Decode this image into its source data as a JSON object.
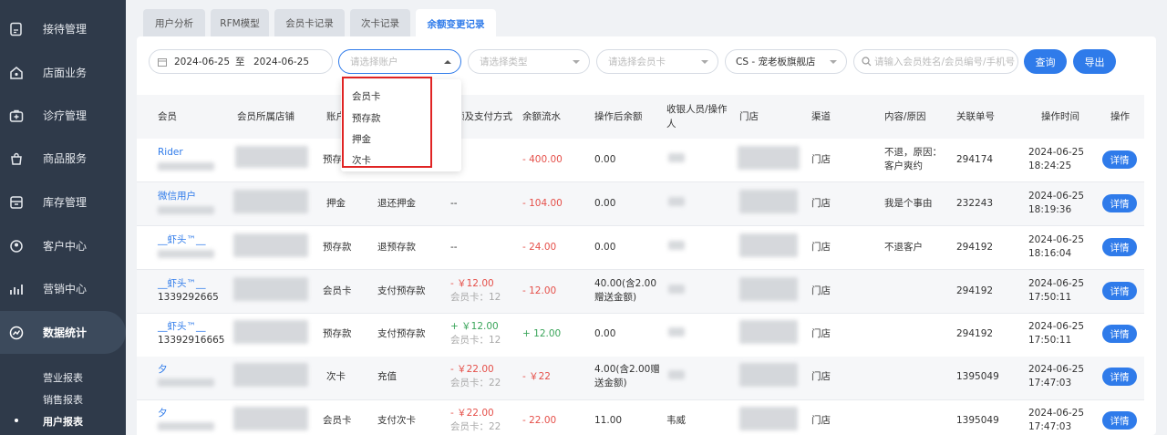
{
  "sidebar": {
    "items": [
      {
        "label": "接待管理",
        "icon": "reception-icon"
      },
      {
        "label": "店面业务",
        "icon": "store-icon"
      },
      {
        "label": "诊疗管理",
        "icon": "medical-kit-icon"
      },
      {
        "label": "商品服务",
        "icon": "goods-bag-icon"
      },
      {
        "label": "库存管理",
        "icon": "inventory-icon"
      },
      {
        "label": "客户中心",
        "icon": "customer-icon"
      },
      {
        "label": "营销中心",
        "icon": "marketing-chart-icon"
      },
      {
        "label": "数据统计",
        "icon": "statistics-icon"
      }
    ],
    "subitems": [
      "营业报表",
      "销售报表",
      "用户报表"
    ]
  },
  "tabs": [
    "用户分析",
    "RFM模型",
    "会员卡记录",
    "次卡记录",
    "余额变更记录"
  ],
  "filters": {
    "date_start": "2024-06-25",
    "date_sep": "至",
    "date_end": "2024-06-25",
    "account_placeholder": "请选择账户",
    "type_placeholder": "请选择类型",
    "card_placeholder": "请选择会员卡",
    "store": "CS - 宠老板旗舰店",
    "search_placeholder": "请输入会员姓名/会员编号/手机号",
    "query_label": "查询",
    "export_label": "导出"
  },
  "dropdown_options": [
    "会员卡",
    "预存款",
    "押金",
    "次卡"
  ],
  "columns": [
    "会员",
    "会员所属店铺",
    "账户",
    "金额及支付方式",
    "余额流水",
    "操作后余额",
    "收银人员/操作人",
    "门店",
    "渠道",
    "内容/原因",
    "关联单号",
    "操作时间",
    "操作"
  ],
  "rows": [
    {
      "member": "Rider",
      "phone": "",
      "account": "预存款",
      "type": "",
      "pay": "",
      "pay2": "",
      "flow": "- 400.00",
      "balance": "0.00",
      "staff": "",
      "channel": "门店",
      "reason": "不退，原因：客户爽约",
      "order": "294174",
      "time": "2024-06-25 18:24:25",
      "action": "详情"
    },
    {
      "member": "微信用户",
      "phone": "",
      "account": "押金",
      "type": "退还押金",
      "pay": "--",
      "pay2": "",
      "flow": "- 104.00",
      "balance": "0.00",
      "staff": "",
      "channel": "门店",
      "reason": "我是个事由",
      "order": "232243",
      "time": "2024-06-25 18:19:36",
      "action": "详情"
    },
    {
      "member": "__虾头™__",
      "phone": "",
      "account": "预存款",
      "type": "退预存款",
      "pay": "--",
      "pay2": "",
      "flow": "- 24.00",
      "balance": "0.00",
      "staff": "",
      "channel": "门店",
      "reason": "不退客户",
      "order": "294192",
      "time": "2024-06-25 18:16:04",
      "action": "详情"
    },
    {
      "member": "__虾头™__",
      "phone": "1339292665",
      "account": "会员卡",
      "type": "支付预存款",
      "pay": "- ￥12.00",
      "pay2": "会员卡：12",
      "flow": "- 12.00",
      "balance": "40.00(含2.00赠送金额)",
      "staff": "",
      "channel": "门店",
      "reason": "",
      "order": "294192",
      "time": "2024-06-25 17:50:11",
      "action": "详情"
    },
    {
      "member": "__虾头™__",
      "phone": "13392916665",
      "account": "预存款",
      "type": "支付预存款",
      "pay": "+ ￥12.00",
      "pay2": "会员卡：12",
      "flow": "+ 12.00",
      "balance": "0.00",
      "staff": "",
      "channel": "门店",
      "reason": "",
      "order": "294192",
      "time": "2024-06-25 17:50:11",
      "action": "详情"
    },
    {
      "member": "夕",
      "phone": "",
      "account": "次卡",
      "type": "充值",
      "pay": "- ￥22.00",
      "pay2": "会员卡：22",
      "flow": "- ￥22",
      "balance": "4.00(含2.00赠送金额)",
      "staff": "",
      "channel": "门店",
      "reason": "",
      "order": "1395049",
      "time": "2024-06-25 17:47:03",
      "action": "详情"
    },
    {
      "member": "夕",
      "phone": "",
      "account": "会员卡",
      "type": "支付次卡",
      "pay": "- ￥22.00",
      "pay2": "会员卡：22",
      "flow": "- 22.00",
      "balance": "11.00",
      "staff": "韦威",
      "channel": "门店",
      "reason": "",
      "order": "1395049",
      "time": "2024-06-25 17:47:03",
      "action": "详情"
    }
  ]
}
